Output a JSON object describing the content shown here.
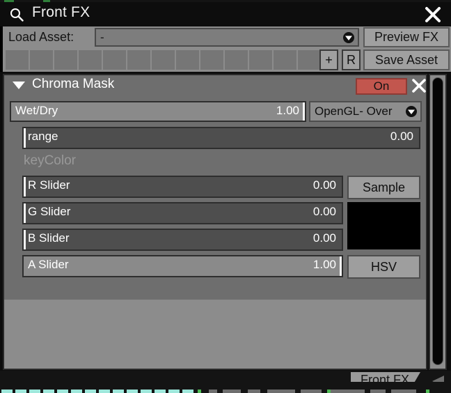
{
  "window": {
    "title": "Front FX",
    "search_icon": "search-icon",
    "close_icon": "close-icon"
  },
  "asset_bar": {
    "load_asset_label": "Load Asset:",
    "load_asset_value": "-",
    "load_asset_caret": "chevron-down-icon",
    "preview_fx_label": "Preview FX",
    "save_asset_label": "Save Asset",
    "add_slot_label": "+",
    "reset_slot_label": "R",
    "slot_count": 13
  },
  "module": {
    "twisty_icon": "triangle-down-icon",
    "title": "Chroma Mask",
    "enable_label": "On",
    "enable_color": "#c2564e",
    "close_icon": "close-icon",
    "wet_dry": {
      "label": "Wet/Dry",
      "value": "1.00",
      "fill_percent": 100
    },
    "blend_mode": {
      "value": "OpenGL- Over",
      "caret": "chevron-down-icon"
    },
    "params": {
      "range": {
        "label": "range",
        "value": "0.00",
        "fill_percent": 0
      },
      "key_color_label": "keyColor",
      "r": {
        "label": "R Slider",
        "value": "0.00",
        "fill_percent": 0
      },
      "g": {
        "label": "G Slider",
        "value": "0.00",
        "fill_percent": 0
      },
      "b": {
        "label": "B Slider",
        "value": "0.00",
        "fill_percent": 0
      },
      "a": {
        "label": "A Slider",
        "value": "1.00",
        "fill_percent": 100
      },
      "sample_label": "Sample",
      "hsv_label": "HSV",
      "swatch_color": "#000000"
    }
  },
  "tabbar": {
    "tab_label": "Front FX",
    "overflow_icon": "triangle-left-icon"
  }
}
